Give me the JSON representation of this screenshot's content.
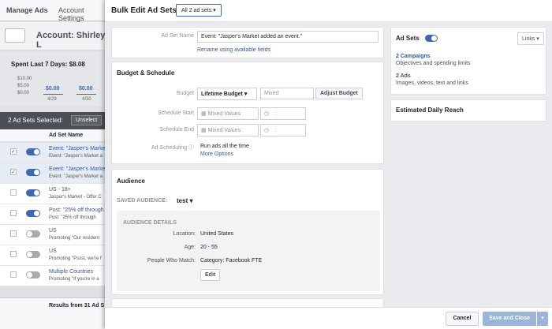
{
  "background": {
    "manage_ads": "Manage Ads",
    "account_settings": "Account Settings",
    "account_label": "Account: Shirley L",
    "spent_title": "Spent Last 7 Days: $8.08",
    "y_ticks": [
      "$10.00",
      "$5.00",
      "$0.00"
    ],
    "day_values": [
      "$0.00",
      "$0.00"
    ],
    "day_dates": [
      "4/29",
      "4/30"
    ],
    "selected_text": "2 Ad Sets Selected:",
    "unselect": "Unselect",
    "column_header": "Ad Set Name",
    "rows": [
      {
        "name": "Event: \"Jasper's Market",
        "sub": "Event: \"Jasper's Market a",
        "checked": true,
        "on": true
      },
      {
        "name": "Event: \"Jasper's Market",
        "sub": "Event: \"Jasper's Market a",
        "checked": true,
        "on": true
      },
      {
        "name": "US - 18+",
        "sub": "Jasper's Market - Offer C",
        "checked": false,
        "on": true
      },
      {
        "name": "Post: \"25% off through",
        "sub": "Post: \"25% off through",
        "checked": false,
        "on": true
      },
      {
        "name": "US",
        "sub": "Promoting \"Our resident",
        "checked": false,
        "on": false
      },
      {
        "name": "US",
        "sub": "Promoting \"Pssst, we're f",
        "checked": false,
        "on": false
      },
      {
        "name": "Multiple Countries",
        "sub": "Promoting \"If you're in a",
        "checked": false,
        "on": false
      }
    ],
    "results": "Results from 31 Ad S"
  },
  "panel": {
    "title": "Bulk Edit Ad Sets",
    "dropdown": "All 2 ad sets",
    "ad_set_name_label": "Ad Set Name",
    "ad_set_name_value": "Event: \"Jasper's Market added an event.\"",
    "rename_link": "Rename using available fields",
    "budget_section": "Budget & Schedule",
    "budget_label": "Budget",
    "budget_type": "Lifetime Budget",
    "budget_placeholder": "Mixed",
    "adjust_budget": "Adjust Budget",
    "schedule_start_label": "Schedule Start",
    "schedule_end_label": "Schedule End",
    "mixed_values": "Mixed Values",
    "time_colon": ":",
    "ad_scheduling_label": "Ad Scheduling",
    "ad_scheduling_value": "Run ads all the time",
    "more_options": "More Options",
    "audience_section": "Audience",
    "saved_audience_label": "SAVED AUDIENCE:",
    "saved_audience_value": "test",
    "audience_details": "AUDIENCE DETAILS",
    "location_label": "Location:",
    "location_value": "United States",
    "age_label": "Age:",
    "age_value": "20 - 55",
    "match_label": "People Who Match:",
    "match_value": "Category: Facebook FTE",
    "edit": "Edit",
    "ad_sets_label": "Ad Sets",
    "links_button": "Links",
    "campaigns_link": "2 Campaigns",
    "campaigns_desc": "Objectives and spending limits",
    "ads_link": "2 Ads",
    "ads_desc": "Images, videos, text and links",
    "reach_title": "Estimated Daily Reach",
    "cancel": "Cancel",
    "save_close": "Save and Close"
  },
  "colors": {
    "accent": "#4267b2",
    "save_disabled": "#9cb4d8"
  }
}
